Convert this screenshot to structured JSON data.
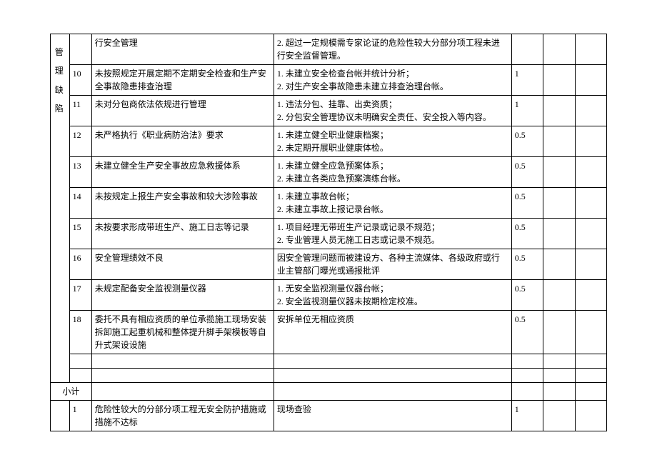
{
  "category_label": "管理缺陷",
  "subtotal_label": "小计",
  "rows_top": {
    "partial": {
      "issue_tail": "行安全管理",
      "basis": "2. 超过一定规模需专家论证的危险性较大分部分项工程未进行安全监督管理。"
    }
  },
  "rows": [
    {
      "no": "10",
      "issue": "未按照规定开展定期不定期安全检查和生产安全事故隐患排查治理",
      "basis": "1. 未建立安全检查台帐并统计分析；\n2. 对生产安全事故隐患未建立排查治理台帐。",
      "score": "1"
    },
    {
      "no": "11",
      "issue": "未对分包商依法依规进行管理",
      "basis": "1. 违法分包、挂靠、出卖资质；\n2. 分包安全管理协议未明确安全责任、安全投入等内容。",
      "score": "1"
    },
    {
      "no": "12",
      "issue": "未严格执行《职业病防治法》要求",
      "basis": "1. 未建立健全职业健康档案；\n2. 未定期开展职业健康体检。",
      "score": "0.5"
    },
    {
      "no": "13",
      "issue": "未建立健全生产安全事故应急救援体系",
      "basis": "1. 未建立健全应急预案体系；\n2. 未建立各类应急预案演练台帐。",
      "score": "0.5"
    },
    {
      "no": "14",
      "issue": "未按规定上报生产安全事故和较大涉险事故",
      "basis": "1. 未建立事故台帐；\n2. 未建立事故上报记录台帐。",
      "score": "0.5"
    },
    {
      "no": "15",
      "issue": "未按要求形成带班生产、施工日志等记录",
      "basis": "1. 项目经理无带班生产记录或记录不规范；\n2. 专业管理人员无施工日志或记录不规范。",
      "score": "0.5"
    },
    {
      "no": "16",
      "issue": "安全管理绩效不良",
      "basis": "因安全管理问题而被建设方、各种主流媒体、各级政府或行业主管部门曝光或通报批评",
      "score": "0.5"
    },
    {
      "no": "17",
      "issue": "未规定配备安全监视测量仪器",
      "basis": "1. 无安全监视测量仪器台帐；\n2. 安全监视测量仪器未按期检定校准。",
      "score": "0.5"
    },
    {
      "no": "18",
      "issue": "委托不具有相应资质的单位承揽施工现场安装拆卸施工起重机械和整体提升脚手架模板等自升式架设设施",
      "basis": "安拆单位无相应资质",
      "score": "0.5"
    }
  ],
  "rows_bottom": [
    {
      "no": "1",
      "issue": "危险性较大的分部分项工程无安全防护措施或措施不达标",
      "basis": "现场查验",
      "score": "1"
    }
  ]
}
